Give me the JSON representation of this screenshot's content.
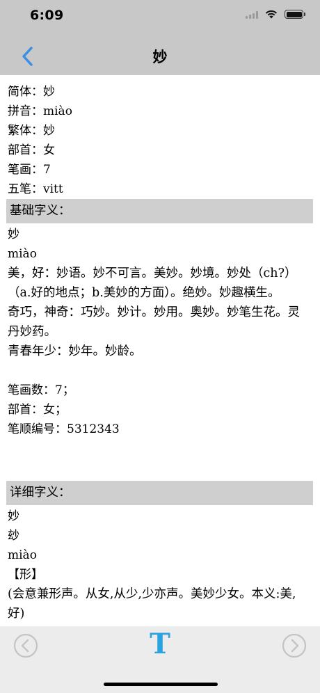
{
  "status_bar": {
    "time": "6:09",
    "icons": [
      "signal-icon",
      "wifi-icon",
      "battery-icon"
    ]
  },
  "nav": {
    "title": "妙",
    "back_icon": "chevron-left-icon",
    "accent_color": "#3a8ee6"
  },
  "basic_info": [
    "简体：妙",
    "拼音：miào",
    "繁体：妙",
    "部首：女",
    "笔画：7",
    "五笔：vitt"
  ],
  "basic_section": {
    "heading": "基础字义：",
    "lines": [
      "妙",
      "miào"
    ],
    "paragraphs": [
      "美，好：妙语。妙不可言。美妙。妙境。妙处（ch?）（a.好的地点；b.美妙的方面）。绝妙。妙趣横生。",
      "奇巧，神奇：巧妙。妙计。妙用。奥妙。妙笔生花。灵丹妙药。",
      "青春年少：妙年。妙龄。"
    ],
    "stats": [
      "笔画数：7；",
      "部首：女；",
      "笔顺编号：5312343"
    ]
  },
  "detail_section": {
    "heading": "详细字义：",
    "lines": [
      "妙",
      "玅",
      "miào",
      "【形】"
    ],
    "paragraphs": [
      "(会意兼形声。从女,从少,少亦声。美妙少女。本义:美,好)"
    ]
  },
  "toolbar": {
    "prev_icon": "circle-chevron-left-icon",
    "font_label": "T",
    "next_icon": "circle-chevron-right-icon",
    "font_color": "#2aa3e0"
  }
}
